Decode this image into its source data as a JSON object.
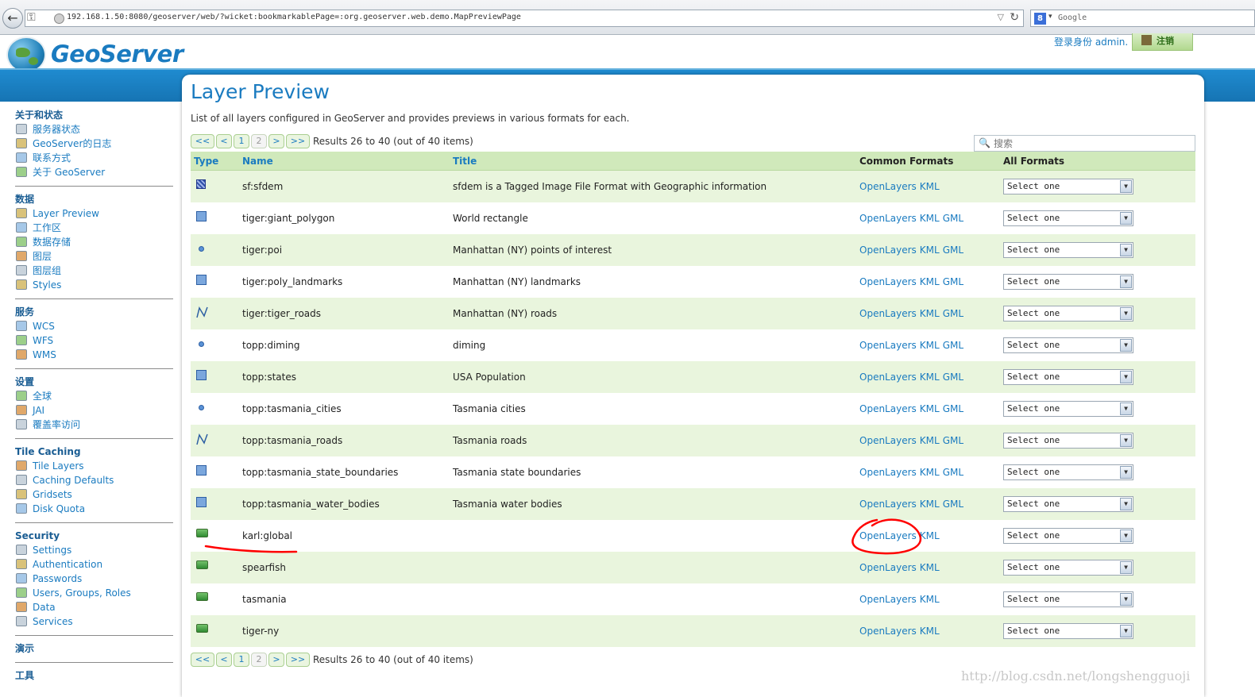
{
  "browser": {
    "url": "192.168.1.50:8080/geoserver/web/?wicket:bookmarkablePage=:org.geoserver.web.demo.MapPreviewPage",
    "search_placeholder": "Google"
  },
  "header": {
    "logo_text": "GeoServer",
    "login_info": "登录身份 admin.",
    "logout_label": "注销"
  },
  "sidebar": {
    "groups": [
      {
        "title": "关于和状态",
        "items": [
          "服务器状态",
          "GeoServer的日志",
          "联系方式",
          "关于 GeoServer"
        ]
      },
      {
        "title": "数据",
        "items": [
          "Layer Preview",
          "工作区",
          "数据存储",
          "图层",
          "图层组",
          "Styles"
        ]
      },
      {
        "title": "服务",
        "items": [
          "WCS",
          "WFS",
          "WMS"
        ]
      },
      {
        "title": "设置",
        "items": [
          "全球",
          "JAI",
          "覆盖率访问"
        ]
      },
      {
        "title": "Tile Caching",
        "items": [
          "Tile Layers",
          "Caching Defaults",
          "Gridsets",
          "Disk Quota"
        ]
      },
      {
        "title": "Security",
        "items": [
          "Settings",
          "Authentication",
          "Passwords",
          "Users, Groups, Roles",
          "Data",
          "Services"
        ]
      },
      {
        "title": "演示",
        "items": []
      },
      {
        "title": "工具",
        "items": []
      }
    ]
  },
  "main": {
    "title": "Layer Preview",
    "description": "List of all layers configured in GeoServer and provides previews in various formats for each.",
    "pager": {
      "first": "<<",
      "prev": "<",
      "page1": "1",
      "page2": "2",
      "next": ">",
      "last": ">>",
      "info": "Results 26 to 40 (out of 40 items)"
    },
    "filter_placeholder": "搜索",
    "columns": {
      "type": "Type",
      "name": "Name",
      "title": "Title",
      "common": "Common Formats",
      "all": "All Formats"
    },
    "select_default": "Select one",
    "rows": [
      {
        "type": "raster",
        "name": "sf:sfdem",
        "title": "sfdem is a Tagged Image File Format with Geographic information",
        "formats": [
          "OpenLayers",
          "KML"
        ]
      },
      {
        "type": "polygon",
        "name": "tiger:giant_polygon",
        "title": "World rectangle",
        "formats": [
          "OpenLayers",
          "KML",
          "GML"
        ]
      },
      {
        "type": "point",
        "name": "tiger:poi",
        "title": "Manhattan (NY) points of interest",
        "formats": [
          "OpenLayers",
          "KML",
          "GML"
        ]
      },
      {
        "type": "polygon",
        "name": "tiger:poly_landmarks",
        "title": "Manhattan (NY) landmarks",
        "formats": [
          "OpenLayers",
          "KML",
          "GML"
        ]
      },
      {
        "type": "line",
        "name": "tiger:tiger_roads",
        "title": "Manhattan (NY) roads",
        "formats": [
          "OpenLayers",
          "KML",
          "GML"
        ]
      },
      {
        "type": "point",
        "name": "topp:diming",
        "title": "diming",
        "formats": [
          "OpenLayers",
          "KML",
          "GML"
        ]
      },
      {
        "type": "polygon",
        "name": "topp:states",
        "title": "USA Population",
        "formats": [
          "OpenLayers",
          "KML",
          "GML"
        ]
      },
      {
        "type": "point",
        "name": "topp:tasmania_cities",
        "title": "Tasmania cities",
        "formats": [
          "OpenLayers",
          "KML",
          "GML"
        ]
      },
      {
        "type": "line",
        "name": "topp:tasmania_roads",
        "title": "Tasmania roads",
        "formats": [
          "OpenLayers",
          "KML",
          "GML"
        ]
      },
      {
        "type": "polygon",
        "name": "topp:tasmania_state_boundaries",
        "title": "Tasmania state boundaries",
        "formats": [
          "OpenLayers",
          "KML",
          "GML"
        ]
      },
      {
        "type": "polygon",
        "name": "topp:tasmania_water_bodies",
        "title": "Tasmania water bodies",
        "formats": [
          "OpenLayers",
          "KML",
          "GML"
        ]
      },
      {
        "type": "group",
        "name": "karl:global",
        "title": "",
        "formats": [
          "OpenLayers",
          "KML"
        ]
      },
      {
        "type": "group",
        "name": "spearfish",
        "title": "",
        "formats": [
          "OpenLayers",
          "KML"
        ]
      },
      {
        "type": "group",
        "name": "tasmania",
        "title": "",
        "formats": [
          "OpenLayers",
          "KML"
        ]
      },
      {
        "type": "group",
        "name": "tiger-ny",
        "title": "",
        "formats": [
          "OpenLayers",
          "KML"
        ]
      }
    ]
  },
  "watermark": "http://blog.csdn.net/longshengguoji",
  "colors": {
    "accent_blue": "#1a7bc0",
    "row_green": "#e9f5dd",
    "header_green": "#d0e9bb",
    "annotation_red": "#ff0000"
  }
}
